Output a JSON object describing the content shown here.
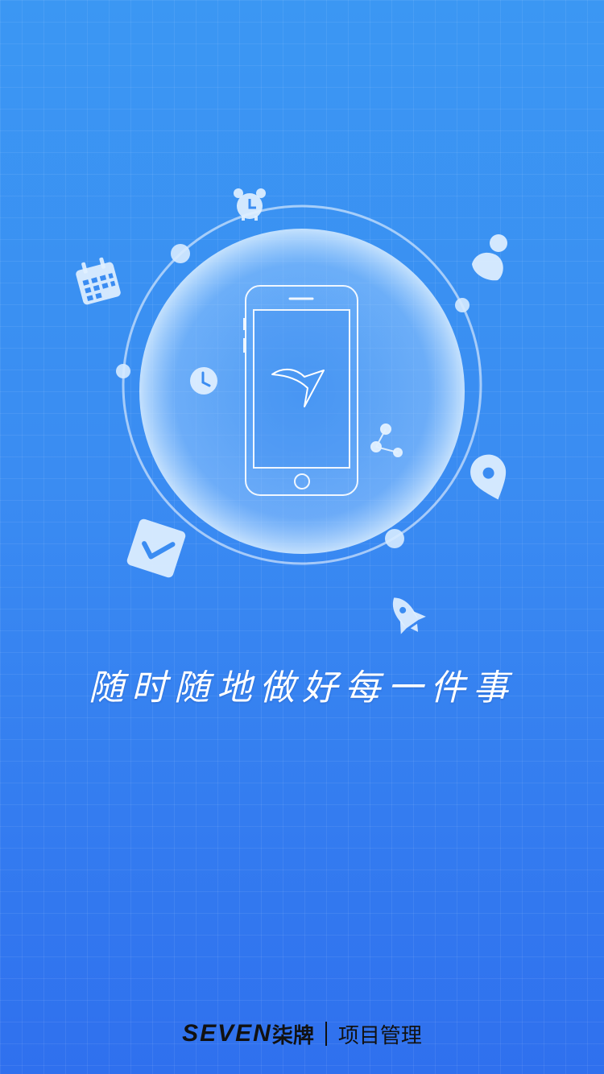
{
  "tagline": "随时随地做好每一件事",
  "brand": {
    "logo_text": "SEVEN",
    "logo_cn": "柒牌",
    "product": "项目管理"
  },
  "icons": [
    "alarm-clock-icon",
    "calendar-icon",
    "user-icon",
    "clock-icon",
    "share-icon",
    "location-pin-icon",
    "checkbox-icon",
    "rocket-icon",
    "phone-illustration",
    "brand-bird-icon"
  ],
  "colors": {
    "background_top": "#3b97f3",
    "background_bottom": "#2f70ee",
    "accent_red": "#e0262b"
  }
}
